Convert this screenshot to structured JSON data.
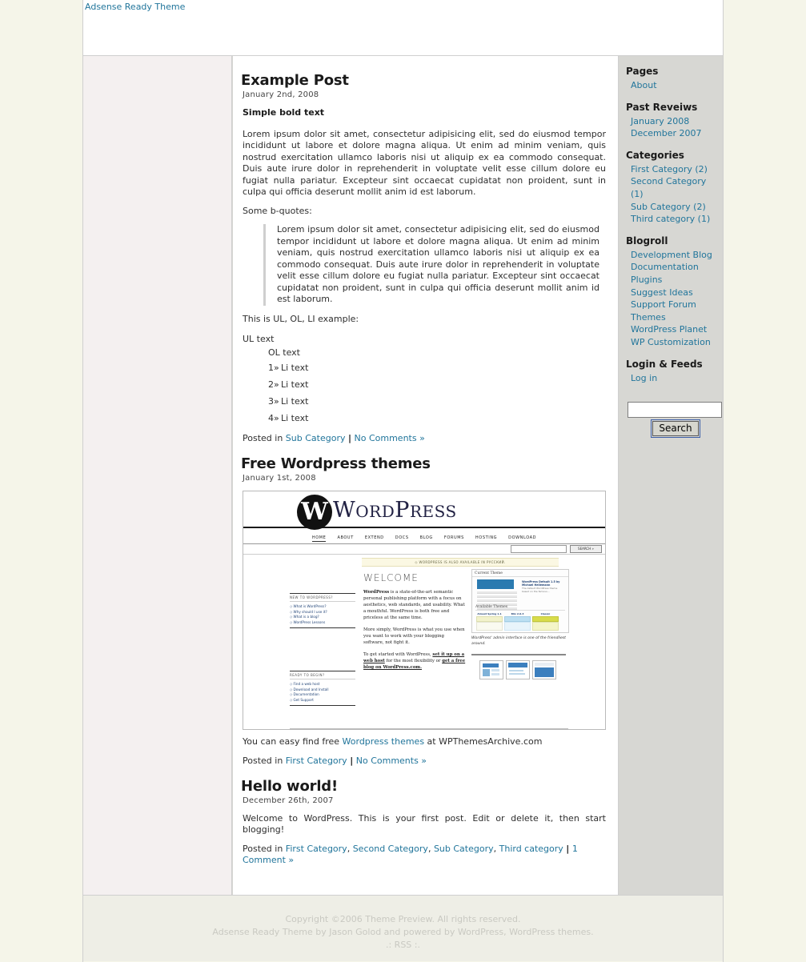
{
  "header": {
    "blog_title": "Adsense Ready Theme"
  },
  "posts": [
    {
      "title": "Example Post",
      "date": "January 2nd, 2008",
      "bold_line": "Simple bold text",
      "paragraph": "Lorem ipsum dolor sit amet, consectetur adipisicing elit, sed do eiusmod tempor incididunt ut labore et dolore magna aliqua. Ut enim ad minim veniam, quis nostrud exercitation ullamco laboris nisi ut aliquip ex ea commodo consequat. Duis aute irure dolor in reprehenderit in voluptate velit esse cillum dolore eu fugiat nulla pariatur. Excepteur sint occaecat cupidatat non proident, sunt in culpa qui officia deserunt mollit anim id est laborum.",
      "quote_intro": "Some b-quotes:",
      "blockquote": "Lorem ipsum dolor sit amet, consectetur adipisicing elit, sed do eiusmod tempor incididunt ut labore et dolore magna aliqua. Ut enim ad minim veniam, quis nostrud exercitation ullamco laboris nisi ut aliquip ex ea commodo consequat. Duis aute irure dolor in reprehenderit in voluptate velit esse cillum dolore eu fugiat nulla pariatur. Excepteur sint occaecat cupidatat non proident, sunt in culpa qui officia deserunt mollit anim id est laborum.",
      "list_intro": "This is UL, OL, LI example:",
      "ul_text": "UL text",
      "ol_text": "OL text",
      "li_items": [
        {
          "marker": "1»",
          "label": "Li text"
        },
        {
          "marker": "2»",
          "label": "Li text"
        },
        {
          "marker": "3»",
          "label": "Li text"
        },
        {
          "marker": "4»",
          "label": "Li text"
        }
      ],
      "meta_prefix": "Posted in",
      "meta_categories": [
        "Sub Category"
      ],
      "meta_separator": "|",
      "meta_comments": "No Comments »"
    },
    {
      "title": "Free Wordpress themes",
      "date": "January 1st, 2008",
      "caption_prefix": "You can easy find free ",
      "caption_link": "Wordpress themes",
      "caption_suffix": " at WPThemesArchive.com",
      "meta_prefix": "Posted in",
      "meta_categories": [
        "First Category"
      ],
      "meta_separator": "|",
      "meta_comments": "No Comments »"
    },
    {
      "title": "Hello world!",
      "date": "December 26th, 2007",
      "paragraph": "Welcome to WordPress. This is your first post. Edit or delete it, then start blogging!",
      "meta_prefix": "Posted in",
      "meta_categories": [
        "First Category",
        "Second Category",
        "Sub Category",
        "Third category"
      ],
      "meta_separator": "|",
      "meta_comments": "1 Comment »"
    }
  ],
  "wordpress_screenshot": {
    "logo_letter": "W",
    "wordmark_parts": [
      "W",
      "ORD",
      "P",
      "RESS"
    ],
    "nav": [
      "HOME",
      "ABOUT",
      "EXTEND",
      "DOCS",
      "BLOG",
      "FORUMS",
      "HOSTING",
      "DOWNLOAD"
    ],
    "search_button": "SEARCH »",
    "notice": "◇ WORDPRESS IS ALSO AVAILABLE IN РУССКИЙ.",
    "left_box_1": {
      "heading": "NEW TO WORDPRESS?",
      "links": [
        "◇ What is WordPress?",
        "◇ Why should I use it?",
        "◇ What is a blog?",
        "◇ WordPress Lessons"
      ]
    },
    "left_box_2": {
      "heading": "READY TO BEGIN?",
      "links": [
        "◇ Find a web host",
        "◇ Download and Install",
        "◇ Documentation",
        "◇ Get Support"
      ]
    },
    "welcome_heading": "WELCOME",
    "paragraph_1_bold": "WordPress",
    "paragraph_1": " is a state-of-the-art semantic personal publishing platform with a focus on aesthetics, web standards, and usability. What a mouthful. WordPress is both free and priceless at the same time.",
    "paragraph_2": "More simply, WordPress is what you use when you want to work with your blogging software, not fight it.",
    "paragraph_3_pre": "To get started with WordPress, ",
    "paragraph_3_link_1": "set it up on a web host",
    "paragraph_3_mid": " for the most flexibility or ",
    "paragraph_3_link_2": "get a free blog on WordPress.com.",
    "admin_current_theme": "Current Theme",
    "admin_theme_name": "WordPress Default 1.5 by Michael Heilemann",
    "admin_theme_desc": "The default WordPress theme based on the famous...",
    "admin_available": "Available Themes",
    "admin_themes": [
      "Almost Spring 1.1",
      "Blix 2.0.3",
      "Classic"
    ],
    "admin_caption": "WordPress' admin interface is one of the friendliest around."
  },
  "sidebar": {
    "sections": [
      {
        "heading": "Pages",
        "items": [
          "About"
        ]
      },
      {
        "heading": "Past Reveiws",
        "items": [
          "January 2008",
          "December 2007"
        ]
      },
      {
        "heading": "Categories",
        "items": [
          "First Category (2)",
          "Second Category (1)",
          "Sub Category (2)",
          "Third category (1)"
        ]
      },
      {
        "heading": "Blogroll",
        "items": [
          "Development Blog",
          "Documentation",
          "Plugins",
          "Suggest Ideas",
          "Support Forum",
          "Themes",
          "WordPress Planet",
          "WP Customization"
        ]
      },
      {
        "heading": "Login & Feeds",
        "items": [
          "Log in"
        ]
      }
    ],
    "search": {
      "value": "",
      "placeholder": "",
      "button_label": "Search"
    }
  },
  "footer": {
    "line1": "Copyright ©2006 Theme Preview. All rights reserved.",
    "line2_a": "Adsense Ready Theme by Jason Golod",
    "line2_b": " and powered by ",
    "line2_c": "WordPress",
    "line2_d": ", ",
    "line2_e": "WordPress themes",
    "line2_f": ".",
    "line3": ".: RSS :."
  },
  "colors": {
    "link": "#21759b",
    "page_bg": "#f5f5e9",
    "content_bg": "#ffffff",
    "left_col_bg": "#f4f0f0",
    "sidebar_bg": "#d7d7d3",
    "footer_bg": "#eeeee6",
    "footer_text": "#c9c9c2"
  }
}
